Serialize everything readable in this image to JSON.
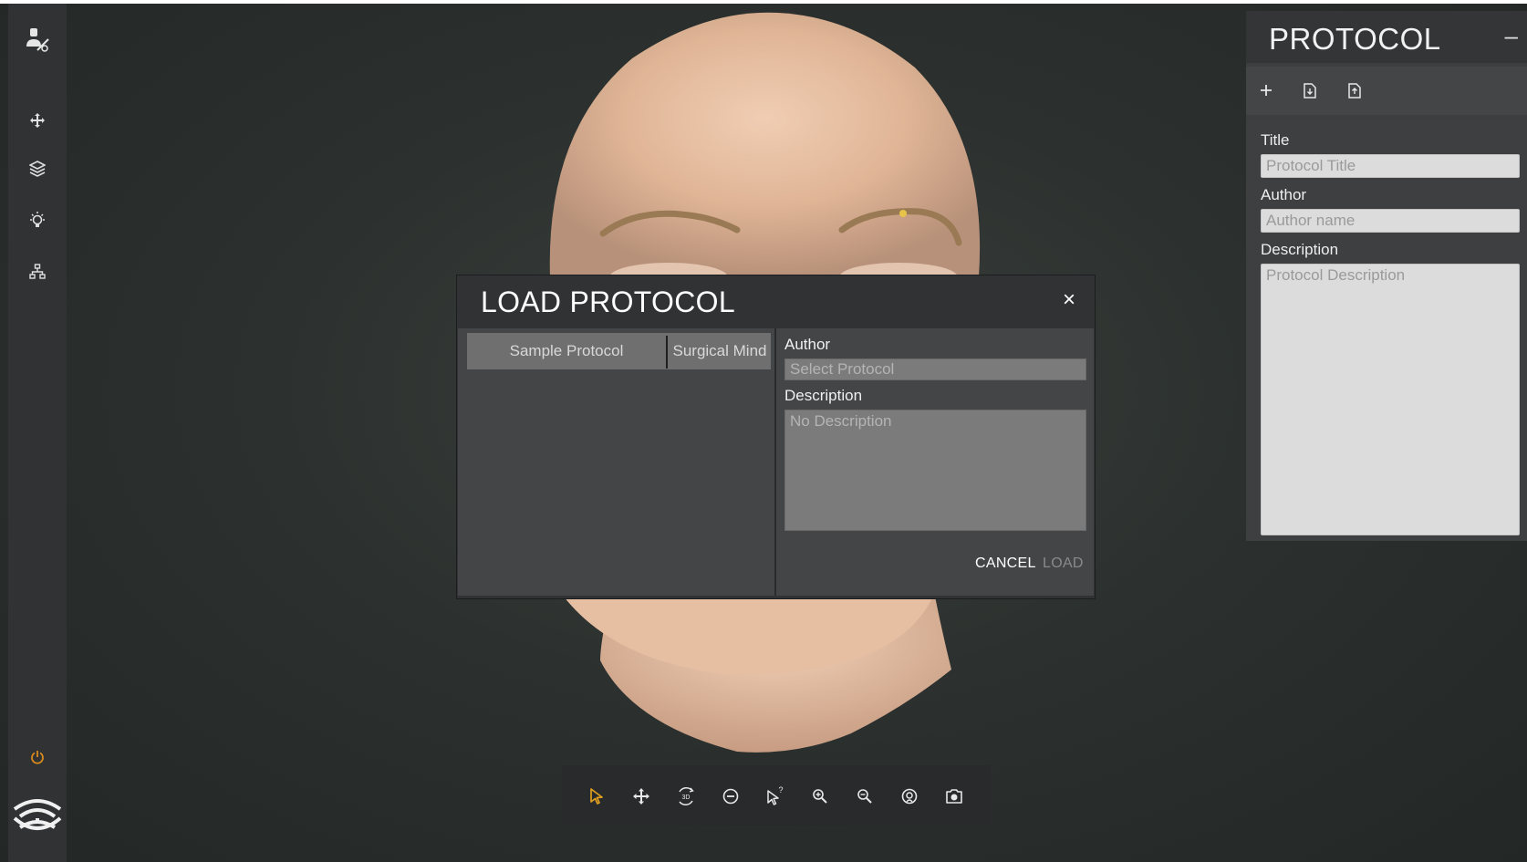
{
  "colors": {
    "accent": "#e0a020",
    "power": "#d98a1c",
    "panel_bg": "#3c3e3f",
    "modal_bg": "#303233",
    "field_bg": "#dcdcdc"
  },
  "sidebar": {
    "items": [
      {
        "icon": "doctor-icon"
      },
      {
        "icon": "move-icon"
      },
      {
        "icon": "layers-icon"
      },
      {
        "icon": "light-icon"
      },
      {
        "icon": "network-icon"
      }
    ],
    "power_icon": "power-icon",
    "logo_icon": "app-logo-icon"
  },
  "protocol_panel": {
    "title": "PROTOCOL",
    "minimize_label": "–",
    "toolbar": [
      {
        "icon": "add-icon"
      },
      {
        "icon": "import-file-icon"
      },
      {
        "icon": "export-file-icon"
      }
    ],
    "fields": {
      "title_label": "Title",
      "title_placeholder": "Protocol Title",
      "author_label": "Author",
      "author_placeholder": "Author name",
      "description_label": "Description",
      "description_placeholder": "Protocol Description"
    }
  },
  "modal": {
    "title": "LOAD PROTOCOL",
    "close_label": "×",
    "list": [
      {
        "name": "Sample Protocol",
        "author": "Surgical Mind"
      }
    ],
    "author_label": "Author",
    "author_placeholder": "Select Protocol",
    "description_label": "Description",
    "description_placeholder": "No Description",
    "cancel_label": "CANCEL",
    "load_label": "LOAD"
  },
  "bottom_toolbar": [
    {
      "icon": "select-cursor-icon",
      "active": true
    },
    {
      "icon": "pan-icon"
    },
    {
      "icon": "rotate-3d-icon"
    },
    {
      "icon": "reset-view-icon"
    },
    {
      "icon": "help-cursor-icon"
    },
    {
      "icon": "zoom-in-icon"
    },
    {
      "icon": "zoom-out-icon"
    },
    {
      "icon": "focus-icon"
    },
    {
      "icon": "camera-icon"
    }
  ]
}
